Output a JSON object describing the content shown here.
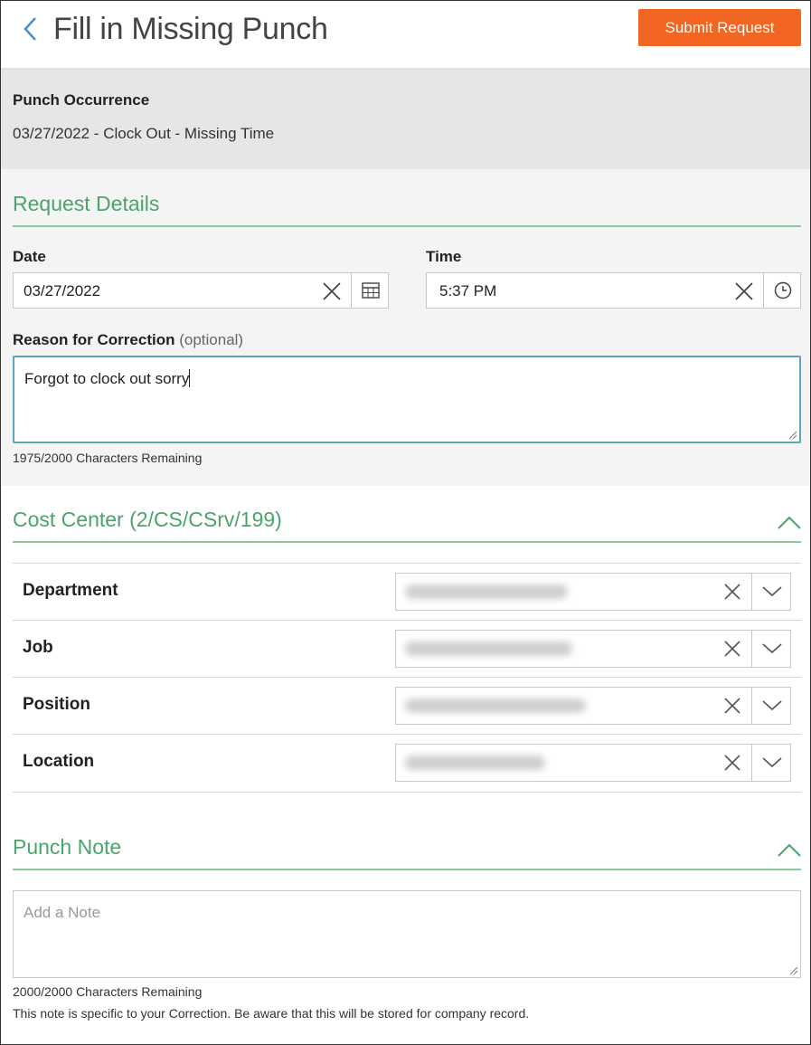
{
  "header": {
    "title": "Fill in Missing Punch",
    "submit_label": "Submit Request"
  },
  "occurrence": {
    "label": "Punch Occurrence",
    "value": "03/27/2022 - Clock Out - Missing Time"
  },
  "request_details": {
    "title": "Request Details",
    "date_label": "Date",
    "date_value": "03/27/2022",
    "time_label": "Time",
    "time_value": "5:37 PM",
    "reason_label": "Reason for Correction",
    "reason_optional": "(optional)",
    "reason_value": "Forgot to clock out sorry",
    "reason_counter": "1975/2000 Characters Remaining"
  },
  "cost_center": {
    "title": "Cost Center (2/CS/CSrv/199)",
    "rows": [
      {
        "label": "Department",
        "value_blurred": true
      },
      {
        "label": "Job",
        "value_blurred": true
      },
      {
        "label": "Position",
        "value_blurred": true
      },
      {
        "label": "Location",
        "value_blurred": true
      }
    ]
  },
  "punch_note": {
    "title": "Punch Note",
    "placeholder": "Add a Note",
    "counter": "2000/2000 Characters Remaining",
    "description": "This note is specific to your Correction. Be aware that this will be stored for company record."
  },
  "colors": {
    "accent_green": "#4ba36d",
    "submit_orange": "#f26522",
    "focus_teal": "#5aa6b8"
  },
  "icons": [
    "chevron-left-icon",
    "close-icon",
    "calendar-icon",
    "clock-icon",
    "chevron-up-icon",
    "chevron-down-icon",
    "resize-handle-icon"
  ]
}
